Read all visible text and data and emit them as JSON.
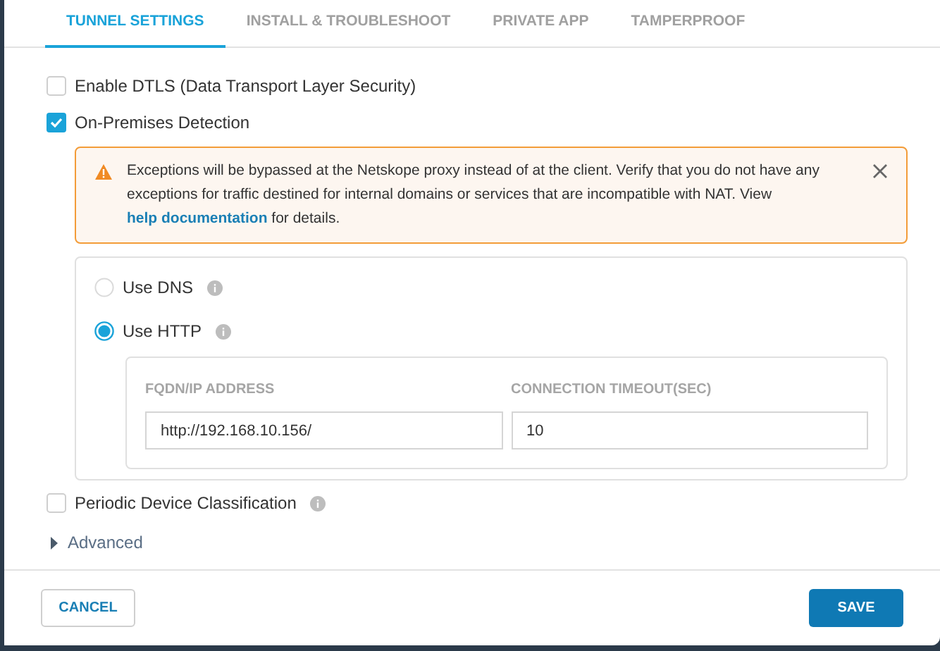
{
  "tabs": [
    {
      "label": "TUNNEL SETTINGS",
      "selected": true
    },
    {
      "label": "INSTALL & TROUBLESHOOT",
      "selected": false
    },
    {
      "label": "PRIVATE APP",
      "selected": false
    },
    {
      "label": "TAMPERPROOF",
      "selected": false
    }
  ],
  "options": [
    {
      "label": "Enable DTLS (Data Transport Layer Security)",
      "checked": false
    },
    {
      "label": "On-Premises Detection",
      "checked": true
    }
  ],
  "alert": {
    "text_before": "Exceptions will be bypassed at the Netskope proxy instead of at the client. Verify that you do not have any exceptions for traffic destined for internal domains or services that are incompatible with NAT. View ",
    "link": "help documentation",
    "text_after": " for details."
  },
  "detection_methods": [
    {
      "label": "Use DNS",
      "selected": false
    },
    {
      "label": "Use HTTP",
      "selected": true
    }
  ],
  "http_fields": [
    {
      "label": "FQDN/IP ADDRESS",
      "value": "http://192.168.10.156/"
    },
    {
      "label": "CONNECTION TIMEOUT(SEC)",
      "value": "10"
    }
  ],
  "periodic": {
    "label": "Periodic Device Classification",
    "checked": false
  },
  "advanced": {
    "label": "Advanced",
    "expanded": false
  },
  "buttons": {
    "cancel": "CANCEL",
    "save": "SAVE"
  }
}
